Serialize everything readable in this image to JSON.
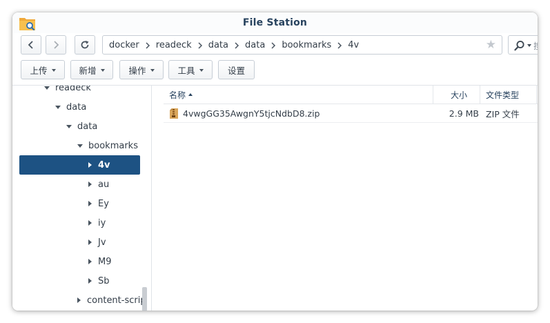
{
  "window": {
    "title": "File Station"
  },
  "search": {
    "placeholder": "搜"
  },
  "breadcrumb": [
    "docker",
    "readeck",
    "data",
    "data",
    "bookmarks",
    "4v"
  ],
  "toolbar": {
    "upload_label": "上传",
    "new_label": "新增",
    "action_label": "操作",
    "tools_label": "工具",
    "settings_label": "设置"
  },
  "tree": {
    "items": [
      {
        "label": "readeck",
        "state": "open"
      },
      {
        "label": "data",
        "state": "open"
      },
      {
        "label": "data",
        "state": "open"
      },
      {
        "label": "bookmarks",
        "state": "open"
      },
      {
        "label": "4v",
        "state": "closed",
        "selected": true
      },
      {
        "label": "au",
        "state": "closed"
      },
      {
        "label": "Ey",
        "state": "closed"
      },
      {
        "label": "iy",
        "state": "closed"
      },
      {
        "label": "Jv",
        "state": "closed"
      },
      {
        "label": "M9",
        "state": "closed"
      },
      {
        "label": "Sb",
        "state": "closed"
      },
      {
        "label": "content-scrip",
        "state": "closed"
      }
    ]
  },
  "filelist": {
    "columns": {
      "name": "名称",
      "size": "大小",
      "type": "文件类型"
    },
    "rows": [
      {
        "name": "4vwgGG35AwgnY5tjcNdbD8.zip",
        "size": "2.9 MB",
        "type": "ZIP 文件",
        "icon": "zip-archive-icon"
      }
    ]
  },
  "colors": {
    "title": "#27425e",
    "selected_bg": "#1d5283",
    "border": "#c6cdd5"
  }
}
